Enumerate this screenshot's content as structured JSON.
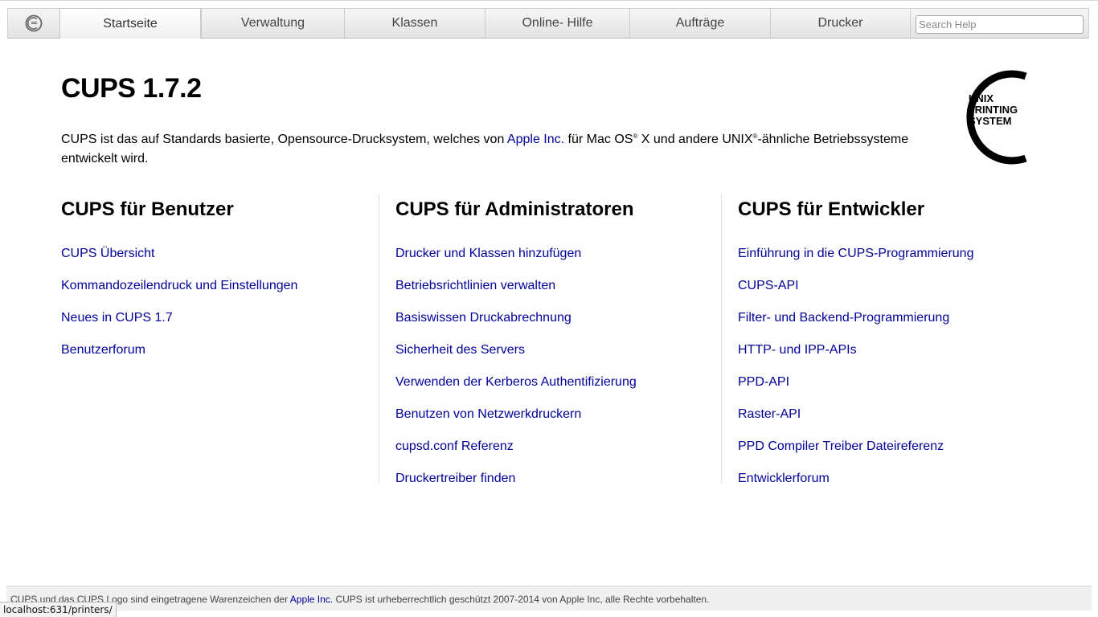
{
  "nav": {
    "tabs": [
      {
        "label": "Startseite",
        "active": true
      },
      {
        "label": "Verwaltung"
      },
      {
        "label": "Klassen"
      },
      {
        "label": "Online- Hilfe"
      },
      {
        "label": "Aufträge"
      },
      {
        "label": "Drucker"
      }
    ],
    "search_placeholder": "Search Help",
    "logo_icon": "cups-logo-icon"
  },
  "header": {
    "title": "CUPS 1.7.2",
    "intro": {
      "part1": "CUPS ist das auf Standards basierte, Opensource-Drucksystem, welches von ",
      "link": "Apple Inc.",
      "part2": " für Mac OS",
      "reg1": "®",
      "part3": " X und andere UNIX",
      "reg2": "®",
      "part4": "-ähnliche Betriebssysteme entwickelt wird."
    },
    "logo_text": [
      "UNIX",
      "PRINTING",
      "SYSTEM"
    ]
  },
  "columns": {
    "users": {
      "heading": "CUPS für Benutzer",
      "links": [
        "CUPS Übersicht",
        "Kommandozeilendruck und Einstellungen",
        "Neues in CUPS 1.7",
        "Benutzerforum"
      ]
    },
    "admins": {
      "heading": "CUPS für Administratoren",
      "links": [
        "Drucker und Klassen hinzufügen",
        "Betriebsrichtlinien verwalten",
        "Basiswissen Druckabrechnung",
        "Sicherheit des Servers",
        "Verwenden der Kerberos Authentifizierung",
        "Benutzen von Netzwerkdruckern",
        "cupsd.conf Referenz",
        "Druckertreiber finden"
      ]
    },
    "devs": {
      "heading": "CUPS für Entwickler",
      "links": [
        "Einführung in die CUPS-Programmierung",
        "CUPS-API",
        "Filter- und Backend-Programmierung",
        "HTTP- und IPP-APIs",
        "PPD-API",
        "Raster-API",
        "PPD Compiler Treiber Dateireferenz",
        "Entwicklerforum"
      ]
    }
  },
  "footer": {
    "part1": "CUPS und das CUPS Logo sind eingetragene Warenzeichen der ",
    "link": "Apple Inc.",
    "part2": " CUPS ist urheberrechtlich geschützt 2007-2014 von Apple Inc, alle Rechte vorbehalten."
  },
  "status_bar": "localhost:631/printers/",
  "colors": {
    "link": "#000099",
    "nav_bg": "#e8e8e8",
    "footer_bg": "#f0f0f0"
  }
}
